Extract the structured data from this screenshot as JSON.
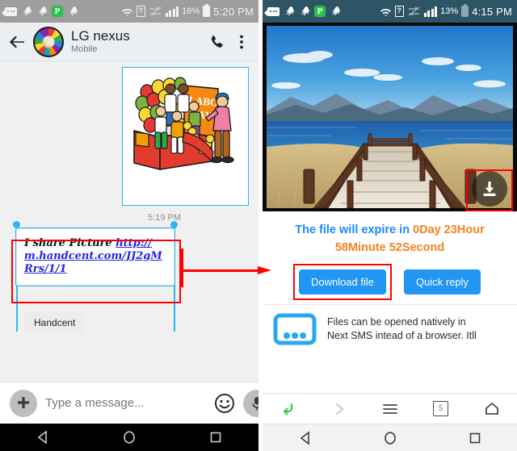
{
  "left_phone": {
    "statusbar": {
      "icons": [
        "message-icon",
        "handcent-icon",
        "handcent-icon",
        "handcent-p-icon",
        "handcent-icon",
        "wifi-icon",
        "sim-unknown-icon",
        "data-off-icon",
        "signal-icon"
      ],
      "p_badge": "P",
      "sim_label": "?",
      "battery_percent": "16%",
      "time": "5:20 PM"
    },
    "header": {
      "back": "back-arrow",
      "contact_name": "LG nexus",
      "contact_subtitle": "Mobile",
      "call": "call-icon",
      "overflow": "more-options-icon"
    },
    "thread": {
      "mms_image_alt": "Labor Day parade float clipart",
      "message_time": "5:19 PM",
      "message_prefix": "I share Picture ",
      "message_link": "http://m.handcent.com/JJ2gMRrs/1/1",
      "app_chip": "Handcent"
    },
    "composer": {
      "add": "plus-icon",
      "placeholder": "Type a message...",
      "emoji": "emoji-icon",
      "mic": "microphone-icon"
    },
    "navbar": {
      "back": "back-triangle-icon",
      "home": "home-circle-icon",
      "recents": "recents-square-icon"
    }
  },
  "right_phone": {
    "statusbar": {
      "p_badge": "P",
      "sim_label": "?",
      "battery_percent": "13%",
      "time": "4:15 PM"
    },
    "viewer": {
      "photo_alt": "Wooden pier over a blue lake with mountains",
      "download_fab": "download-icon"
    },
    "expire": {
      "prefix": "The file will expire in ",
      "days": "0Day",
      "hours": "23Hour",
      "minutes": "58Minute",
      "seconds": "52Second"
    },
    "actions": {
      "download_label": "Download file",
      "quick_reply_label": "Quick reply"
    },
    "promo": {
      "icon": "next-sms-icon",
      "line1": "Files can be opened natively in",
      "line2": "Next SMS intead of a browser. Itll"
    },
    "browser_nav": {
      "back": "browser-back-icon",
      "forward": "browser-forward-icon",
      "menu": "browser-menu-icon",
      "tabs_count": "5",
      "home": "browser-home-icon"
    },
    "navbar": {
      "back": "back-triangle-icon",
      "home": "home-circle-icon",
      "recents": "recents-square-icon"
    }
  },
  "annotations": {
    "message_highlight": "red-box-around-message",
    "flow_arrow": "red-arrow-right",
    "download_fab_highlight": "red-box-around-download-icon",
    "download_button_highlight": "red-box-around-download-file-button",
    "color": "#ff0000"
  }
}
